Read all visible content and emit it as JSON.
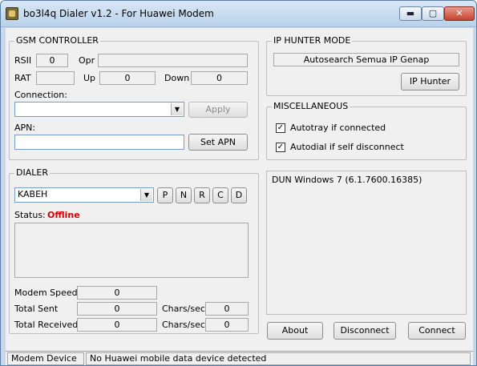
{
  "window": {
    "title": "bo3l4q Dialer v1.2 - For Huawei Modem",
    "minimize": "▬",
    "maximize": "▢",
    "close": "✕"
  },
  "gsm": {
    "title": "GSM CONTROLLER",
    "rssi_label": "RSII",
    "rssi_value": "0",
    "opr_label": "Opr",
    "opr_value": "",
    "rat_label": "RAT",
    "rat_value": "",
    "up_label": "Up",
    "up_value": "0",
    "down_label": "Down",
    "down_value": "0",
    "connection_label": "Connection:",
    "connection_value": "",
    "apply": "Apply",
    "apn_label": "APN:",
    "apn_value": "",
    "set_apn": "Set APN"
  },
  "iphunter": {
    "title": "IP HUNTER MODE",
    "mode": "Autosearch Semua IP Genap",
    "button": "IP Hunter"
  },
  "misc": {
    "title": "MISCELLANEOUS",
    "autotray": "Autotray if connected",
    "autodial": "Autodial if self disconnect",
    "autotray_checked": true,
    "autodial_checked": true
  },
  "dialer": {
    "title": "DIALER",
    "profile": "KABEH",
    "btns": [
      "P",
      "N",
      "R",
      "C",
      "D"
    ],
    "status_label": "Status:",
    "status_value": "Offline",
    "status_color": "#d40000",
    "modem_speed_label": "Modem Speed",
    "modem_speed": "0",
    "total_sent_label": "Total Sent",
    "total_sent": "0",
    "sent_rate_label": "Chars/sec",
    "sent_rate": "0",
    "total_received_label": "Total Received",
    "total_received": "0",
    "recv_rate_label": "Chars/sec",
    "recv_rate": "0"
  },
  "info": {
    "text": "DUN Windows 7  (6.1.7600.16385)"
  },
  "actions": {
    "about": "About",
    "disconnect": "Disconnect",
    "connect": "Connect"
  },
  "statusbar": {
    "device_label": "Modem Device",
    "message": "No Huawei mobile data device detected"
  }
}
